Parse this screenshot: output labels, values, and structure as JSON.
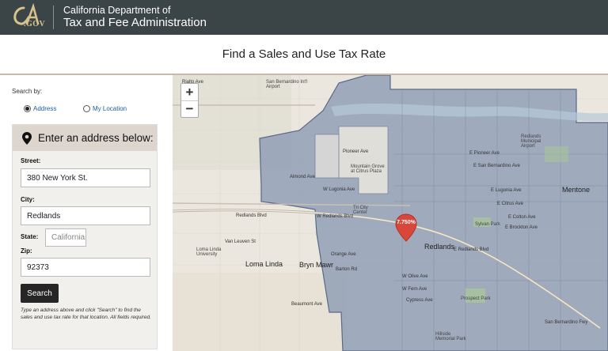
{
  "header": {
    "logo_ca": "CA",
    "logo_gov": ".GOV",
    "agency_line1": "California Department of",
    "agency_line2": "Tax and Fee Administration"
  },
  "page": {
    "title": "Find a Sales and Use Tax Rate"
  },
  "sidebar": {
    "search_by_label": "Search by:",
    "radio_address": "Address",
    "radio_location": "My Location",
    "selected": "Address",
    "panel_title": "Enter an address below:",
    "street_label": "Street:",
    "street_value": "380 New York St.",
    "city_label": "City:",
    "city_value": "Redlands",
    "state_label": "State:",
    "state_value": "California",
    "zip_label": "Zip:",
    "zip_value": "92373",
    "search_button": "Search",
    "help_text": "Type an address above and click \"Search\" to find the sales and use tax rate for that location. All fields required."
  },
  "map": {
    "zoom_in": "+",
    "zoom_out": "−",
    "marker_rate": "7.750%",
    "labels": {
      "rialto_ave": "Rialto Ave",
      "airport": "San Bernardino Int'l Airport",
      "pioneer_ave_w": "Pioneer Ave",
      "e_pioneer_ave": "E Pioneer Ave",
      "almond_ave": "Almond Ave",
      "e_san_bernardino_ave": "E San Bernardino Ave",
      "lugonia_ave": "E Lugonia Ave",
      "w_lugonia_ave": "W Lugonia Ave",
      "mountain_grove": "Mountain Grove at Citrus Plaza",
      "tri_city": "Tri City Center",
      "redlands_blvd": "Redlands Blvd",
      "w_redlands_blvd": "W Redlands Blvd",
      "e_redlands_blvd": "E Redlands Blvd",
      "e_citrus_ave": "E Citrus Ave",
      "e_colton_ave": "E Colton Ave",
      "e_brockton_ave": "E Brockton Ave",
      "loma_linda": "Loma Linda",
      "bryn_mawr": "Bryn Mawr",
      "redlands": "Redlands",
      "mentone": "Mentone",
      "van_leuven": "Van Leuven St",
      "llu": "Loma Linda University",
      "orange_ave": "Orange Ave",
      "barton_rd": "Barton Rd",
      "beaumont_ave": "Beaumont Ave",
      "prospect_park": "Prospect Park",
      "sylvan_park": "Sylvan Park",
      "redlands_airport": "Redlands Municipal Airport",
      "hillside": "Hillside Memorial Park",
      "w_olive_ave": "W Olive Ave",
      "w_fern_ave": "W Fern Ave",
      "cypress_ave": "Cypress Ave",
      "san_bernardino_fwy": "San Bernardino Fwy"
    }
  }
}
